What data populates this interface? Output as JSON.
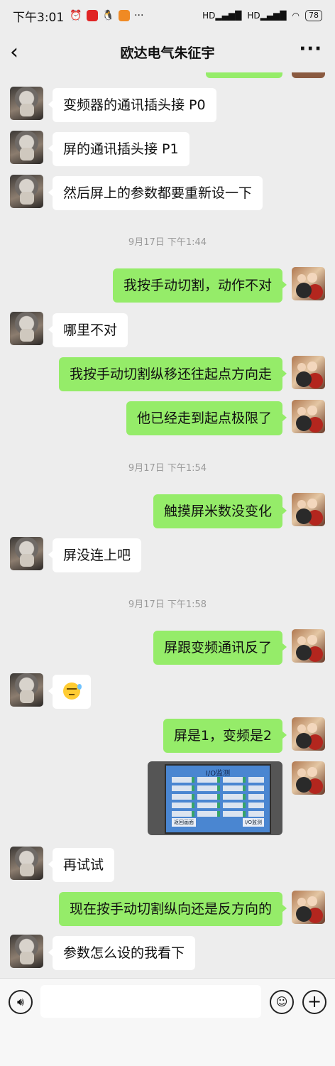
{
  "status_bar": {
    "time": "下午3:01",
    "battery": "78",
    "signal_left": "HD",
    "signal_right": "HD"
  },
  "header": {
    "title": "欧达电气朱征宇"
  },
  "messages": [
    {
      "side": "left",
      "text": "变频器的通讯插头接 P0"
    },
    {
      "side": "left",
      "text": "屏的通讯插头接 P1"
    },
    {
      "side": "left",
      "text": "然后屏上的参数都要重新设一下"
    },
    {
      "type": "timestamp",
      "text": "9月17日 下午1:44"
    },
    {
      "side": "right",
      "text": "我按手动切割，动作不对"
    },
    {
      "side": "left",
      "text": "哪里不对"
    },
    {
      "side": "right",
      "text": "我按手动切割纵移还往起点方向走"
    },
    {
      "side": "right",
      "text": "他已经走到起点极限了"
    },
    {
      "type": "timestamp",
      "text": "9月17日 下午1:54"
    },
    {
      "side": "right",
      "text": "触摸屏米数没变化"
    },
    {
      "side": "left",
      "text": "屏没连上吧"
    },
    {
      "type": "timestamp",
      "text": "9月17日 下午1:58"
    },
    {
      "side": "right",
      "text": "屏跟变频通讯反了"
    },
    {
      "side": "left",
      "type": "emoji",
      "icon": "sweat-smile-emoji"
    },
    {
      "side": "right",
      "text": "屏是1，变频是2"
    },
    {
      "side": "right",
      "type": "image",
      "screen_title": "I/O监测",
      "btn_left": "返回画面",
      "btn_right": "I/O监测"
    },
    {
      "side": "left",
      "text": "再试试"
    },
    {
      "side": "right",
      "text": "现在按手动切割纵向还是反方向的"
    },
    {
      "side": "left",
      "text": "参数怎么设的我看下"
    }
  ],
  "colors": {
    "background": "#ededed",
    "bubble_self": "#95ec69",
    "bubble_other": "#ffffff",
    "timestamp": "#9b9b9b"
  }
}
